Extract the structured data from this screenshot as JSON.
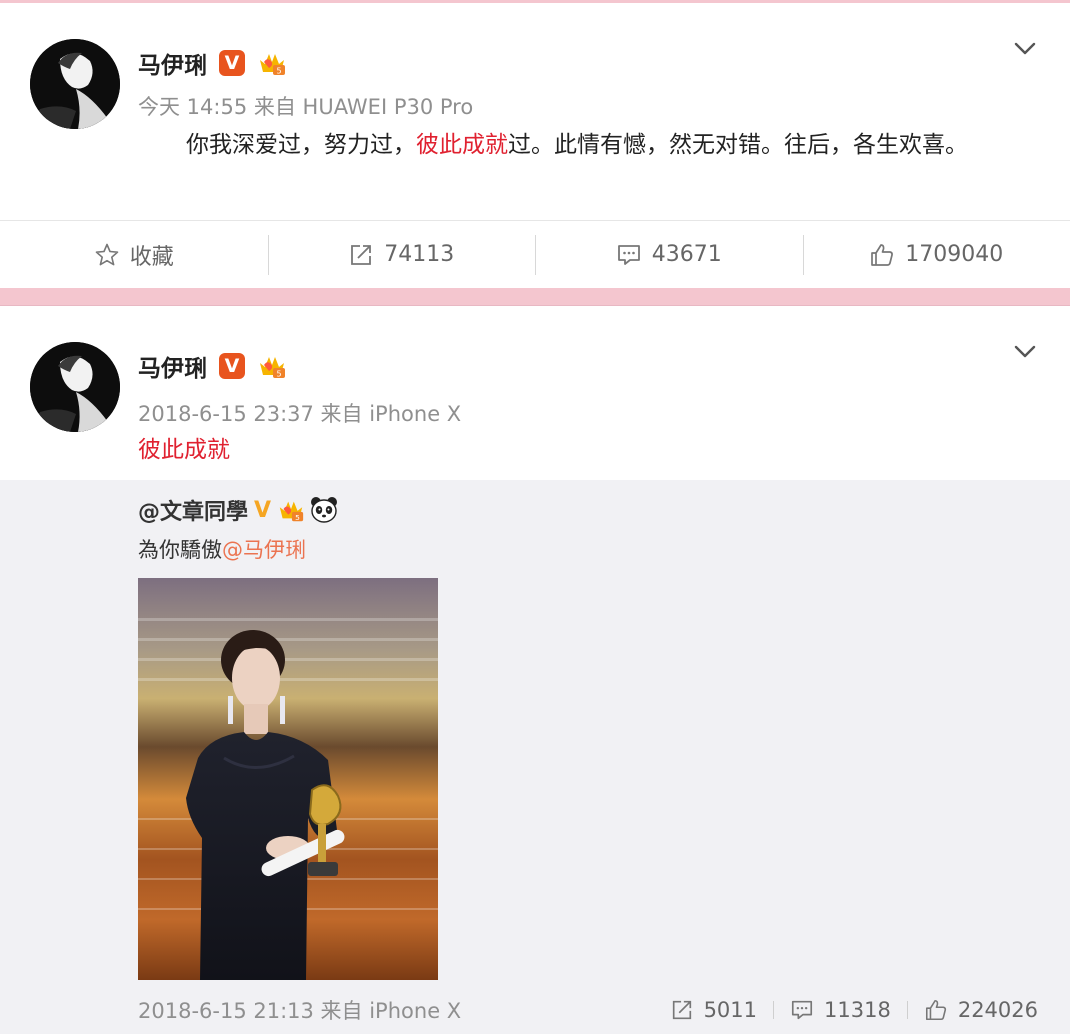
{
  "post1": {
    "username": "马伊琍",
    "verified_label": "V",
    "meta": "今天 14:55 来自 HUAWEI P30 Pro",
    "content_before": "你我深爱过，努力过，",
    "content_highlight": "彼此成就",
    "content_after": "过。此情有憾，然无对错。往后，各生欢喜。",
    "actions": {
      "favorite": "收藏",
      "repost": "74113",
      "comment": "43671",
      "like": "1709040"
    }
  },
  "post2": {
    "username": "马伊琍",
    "verified_label": "V",
    "meta": "2018-6-15 23:37 来自 iPhone X",
    "content": "彼此成就",
    "retweet": {
      "author": "@文章同學",
      "verified_label": "V",
      "text": "為你驕傲",
      "mention": "@马伊琍",
      "meta": "2018-6-15 21:13 来自 iPhone X",
      "repost": "5011",
      "comment": "11318",
      "like": "224026"
    }
  },
  "colors": {
    "highlight_red": "#e02130",
    "mention_orange": "#eb7350",
    "separator_pink": "#f4c6cf",
    "retweet_bg": "#f1f1f4",
    "verified_orange": "#e8541e"
  },
  "icons": [
    "chevron-down-icon",
    "star-icon",
    "share-icon",
    "comment-icon",
    "like-icon",
    "crown-icon",
    "panda-icon"
  ]
}
